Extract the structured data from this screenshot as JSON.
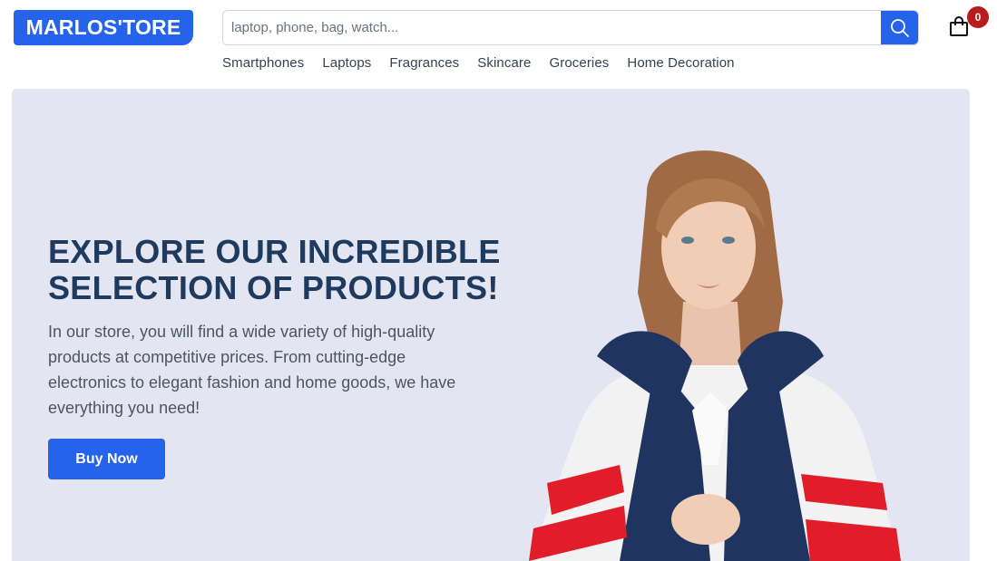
{
  "header": {
    "logo": "MARLOS'TORE",
    "search": {
      "placeholder": "laptop, phone, bag, watch...",
      "value": ""
    },
    "cart_count": "0"
  },
  "nav": {
    "items": [
      {
        "label": "Smartphones"
      },
      {
        "label": "Laptops"
      },
      {
        "label": "Fragrances"
      },
      {
        "label": "Skincare"
      },
      {
        "label": "Groceries"
      },
      {
        "label": "Home Decoration"
      }
    ]
  },
  "hero": {
    "title": "EXPLORE OUR INCREDIBLE SELECTION OF PRODUCTS!",
    "description": "In our store, you will find a wide variety of high-quality products at competitive prices. From cutting-edge electronics to elegant fashion and home goods, we have everything you need!",
    "cta_label": "Buy Now"
  },
  "colors": {
    "brand": "#2563eb",
    "hero_bg": "#e3e6f2",
    "title": "#1e3a5f",
    "badge": "#b91c1c"
  }
}
